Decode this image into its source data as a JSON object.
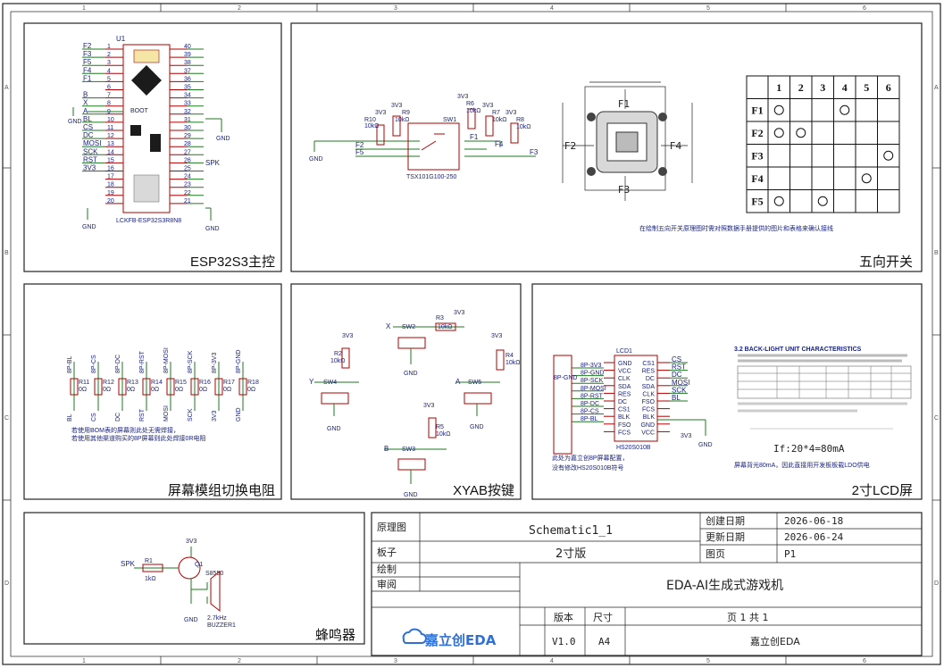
{
  "ruler": {
    "cols": [
      "1",
      "2",
      "3",
      "4",
      "5",
      "6"
    ],
    "rows": [
      "A",
      "B",
      "C",
      "D"
    ]
  },
  "panels": {
    "esp": {
      "title": "ESP32S3主控",
      "ref": "U1",
      "part": "LCKFB-ESP32S3R8N8",
      "left_pins": [
        "1",
        "2",
        "3",
        "4",
        "5",
        "6",
        "7",
        "8",
        "9",
        "10",
        "11",
        "12",
        "13",
        "14",
        "15",
        "16",
        "17",
        "18",
        "19",
        "20"
      ],
      "right_pins": [
        "40",
        "39",
        "38",
        "37",
        "36",
        "35",
        "34",
        "33",
        "32",
        "31",
        "30",
        "29",
        "28",
        "27",
        "26",
        "25",
        "24",
        "23",
        "22",
        "21"
      ],
      "nets_left": [
        "F2",
        "F3",
        "F5",
        "F4",
        "F1",
        "B",
        "X",
        "A",
        "BL",
        "CS",
        "DC",
        "MOSI",
        "SCK",
        "RST",
        "3V3"
      ],
      "net_spk": "SPK",
      "gnd": "GND",
      "boot": "BOOT"
    },
    "switch": {
      "title": "五向开关",
      "parts": {
        "r10": "R10",
        "r10v": "10kΩ",
        "r9": "R9",
        "r9v": "10kΩ",
        "r6": "R6",
        "r6v": "10kΩ",
        "r7": "R7",
        "r7v": "10kΩ",
        "r8": "R8",
        "r8v": "10kΩ",
        "sw": "SW1",
        "swpart": "TSX101G100-250"
      },
      "nets": {
        "f2": "F2",
        "f5": "F5",
        "f1": "F1",
        "f4": "F4",
        "f3": "F3",
        "v1": "3V3",
        "v2": "3V3",
        "v3": "3V3",
        "v4": "3V3",
        "gnd": "GND"
      },
      "note": "在绘制五向开关原理图时需对照数据手册提供的图片和表格来确认接线",
      "mech_labels": {
        "top": "F1",
        "bottom": "F3",
        "left": "F2",
        "right": "F4"
      },
      "table": {
        "cols": [
          "1",
          "2",
          "3",
          "4",
          "5",
          "6"
        ],
        "rows": [
          "F1",
          "F2",
          "F3",
          "F4",
          "F5"
        ],
        "marks": [
          [
            1,
            4
          ],
          [
            1,
            2
          ],
          [
            6
          ],
          [
            5
          ],
          [
            1,
            3
          ]
        ]
      }
    },
    "resist": {
      "title": "屏幕模组切换电阻",
      "nets_top": [
        "8P-BL",
        "8P-CS",
        "8P-DC",
        "8P-RST",
        "8P-MOSI",
        "8P-SCK",
        "8P-3V3",
        "8P-GND"
      ],
      "refs": [
        "R11",
        "R12",
        "R13",
        "R14",
        "R15",
        "R16",
        "R17",
        "R18"
      ],
      "val": "0Ω",
      "nets_bot": [
        "BL",
        "CS",
        "DC",
        "RST",
        "MOSI",
        "SCK",
        "3V3",
        "GND"
      ],
      "note1": "若使用BOM表的屏幕则此处无需焊接，",
      "note2": "若使用其他渠道购买的8P屏幕则此处焊接0R电阻"
    },
    "keys": {
      "title": "XYAB按键",
      "items": [
        {
          "net": "X",
          "sw": "SW2",
          "r": "R3",
          "rv": "10kΩ"
        },
        {
          "net": "Y",
          "sw": "SW4",
          "r": "R2",
          "rv": "10kΩ"
        },
        {
          "net": "A",
          "sw": "SW5",
          "r": "R4",
          "rv": "10kΩ"
        },
        {
          "net": "B",
          "sw": "SW3",
          "r": "R5",
          "rv": "10kΩ"
        }
      ],
      "v": "3V3",
      "gnd": "GND"
    },
    "lcd": {
      "title": "2寸LCD屏",
      "ref": "LCD1",
      "part": "HS20S010B",
      "left_pins": [
        "GND",
        "VCC",
        "CLK",
        "SDA",
        "RES",
        "DC",
        "CS1",
        "BLK",
        "FSO",
        "FCS"
      ],
      "right_pins": [
        "CS1",
        "RES",
        "DC",
        "SDA",
        "CLK",
        "FSO",
        "FCS",
        "BLK",
        "GND",
        "VCC"
      ],
      "nets_8p": [
        "8P-3V3",
        "8P-GND",
        "8P-SCK",
        "8P-MOSI",
        "8P-RST",
        "8P-DC",
        "8P-CS",
        "8P-BL"
      ],
      "nets_right": [
        "CS",
        "RST",
        "DC",
        "MOSI",
        "SCK",
        "BL",
        "3V3",
        "GND"
      ],
      "note1": "此处为嘉立创8P屏幕配置，",
      "note2": "没有修改HS20S010B符号",
      "ds_title": "3.2  BACK-LIGHT UNIT CHARACTERISTICS",
      "formula": "If:20*4=80mA",
      "note3": "屏幕背光80mA，因此直接用开发板板载LDO供电"
    },
    "buzzer": {
      "title": "蜂鸣器",
      "net": "SPK",
      "r": "R1",
      "rv": "1kΩ",
      "q": "Q1",
      "qpart": "S8550",
      "bz": "2.7kHz",
      "bzref": "BUZZER1",
      "v": "3V3",
      "gnd": "GND"
    }
  },
  "title_block": {
    "k_schem": "原理图",
    "v_schem": "Schematic1_1",
    "k_board": "板子",
    "v_board": "2寸版",
    "k_draw": "绘制",
    "k_review": "审阅",
    "k_created": "创建日期",
    "v_created": "2026-06-18",
    "k_updated": "更新日期",
    "v_updated": "2026-06-24",
    "k_page": "图页",
    "v_page": "P1",
    "project": "EDA-AI生成式游戏机",
    "k_ver": "版本",
    "k_size": "尺寸",
    "v_ver": "V1.0",
    "v_size": "A4",
    "pages": "页    1    共    1",
    "company": "嘉立创EDA",
    "logo": "嘉立创EDA"
  }
}
